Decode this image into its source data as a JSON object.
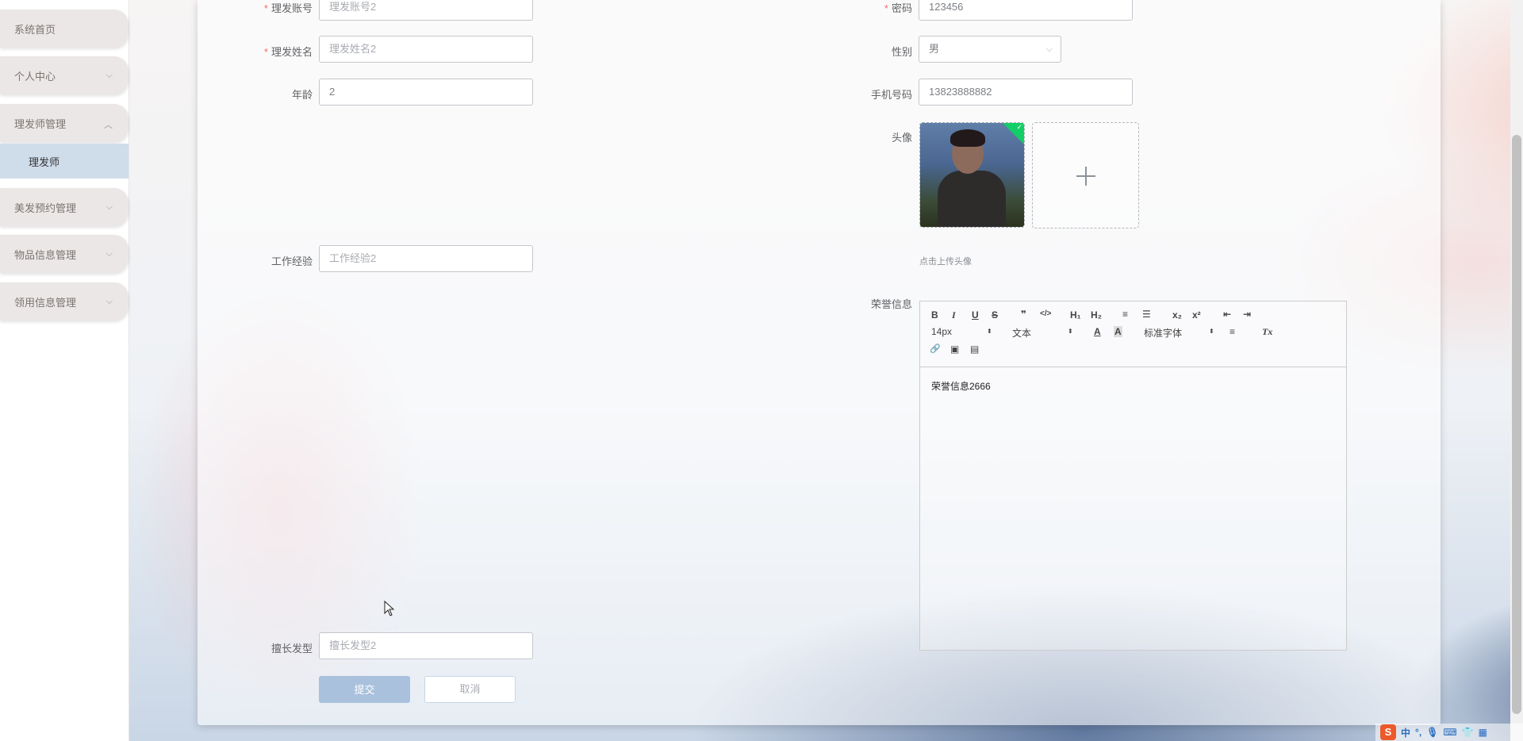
{
  "sidebar": {
    "items": [
      {
        "label": "系统首页"
      },
      {
        "label": "个人中心"
      },
      {
        "label": "理发师管理"
      },
      {
        "label": "美发预约管理"
      },
      {
        "label": "物品信息管理"
      },
      {
        "label": "领用信息管理"
      }
    ],
    "sub_item": {
      "label": "理发师"
    }
  },
  "form": {
    "account": {
      "label": "理发账号",
      "placeholder": "理发账号2"
    },
    "password": {
      "label": "密码",
      "value": "123456"
    },
    "name": {
      "label": "理发姓名",
      "placeholder": "理发姓名2"
    },
    "gender": {
      "label": "性别",
      "value": "男"
    },
    "age": {
      "label": "年龄",
      "value": "2"
    },
    "phone": {
      "label": "手机号码",
      "value": "13823888882"
    },
    "avatar": {
      "label": "头像",
      "hint": "点击上传头像"
    },
    "experience": {
      "label": "工作经验",
      "placeholder": "工作经验2"
    },
    "honor": {
      "label": "荣誉信息",
      "content": "荣誉信息2666",
      "toolbar": {
        "bold": "B",
        "italic": "I",
        "underline": "U",
        "strike": "S",
        "quote": "❞",
        "code": "</>",
        "h1": "H₁",
        "h2": "H₂",
        "ordered_list": "≡",
        "bullet_list": "☰",
        "subscript": "x₂",
        "superscript": "x²",
        "outdent": "⇤",
        "indent": "⇥",
        "size": "14px",
        "format": "文本",
        "font": "标准字体",
        "color": "A",
        "background": "A",
        "align": "≡",
        "clean": "Tx",
        "link": "🔗",
        "image": "▣",
        "video": "▤"
      }
    },
    "specialty": {
      "label": "擅长发型",
      "placeholder": "擅长发型2"
    },
    "submit": "提交",
    "cancel": "取消"
  },
  "tray": {
    "ime_logo": "S",
    "ime_lang": "中",
    "punct": "°,"
  },
  "colors": {
    "accent": "#a9c1dc",
    "submenu_active": "#cfdcea",
    "required": "#f56c6c",
    "upload_success": "#13ce66"
  }
}
